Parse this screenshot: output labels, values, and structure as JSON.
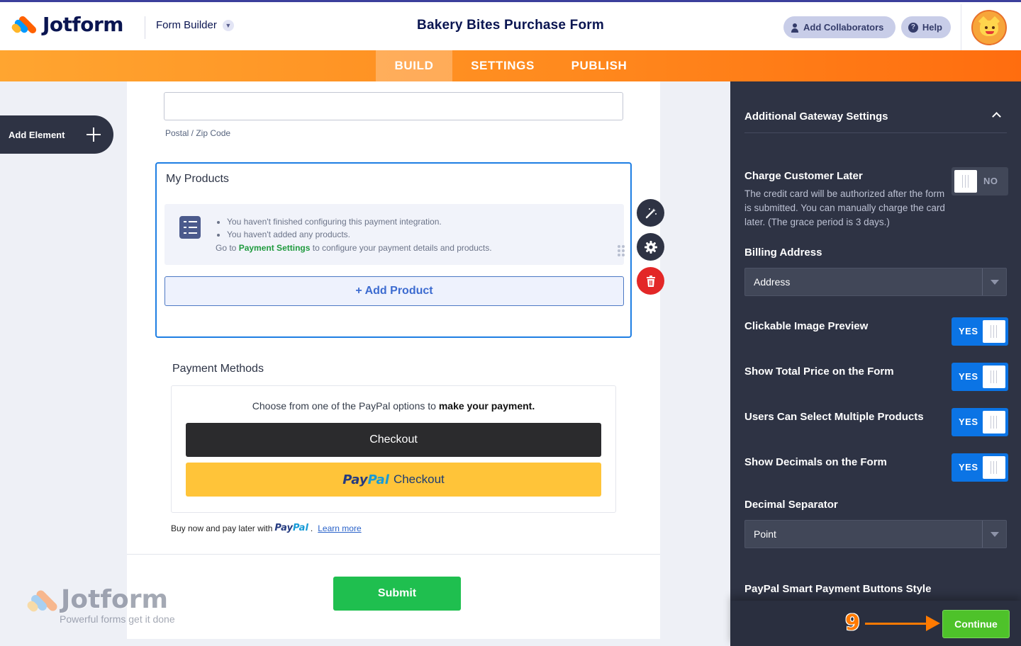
{
  "header": {
    "brand": "Jotform",
    "mode_label": "Form Builder",
    "form_title": "Bakery Bites Purchase Form",
    "collaborators_label": "Add Collaborators",
    "help_label": "Help"
  },
  "tabs": [
    {
      "label": "BUILD",
      "active": true
    },
    {
      "label": "SETTINGS",
      "active": false
    },
    {
      "label": "PUBLISH",
      "active": false
    }
  ],
  "sidebar": {
    "add_element_label": "Add Element"
  },
  "form": {
    "postal_label": "Postal / Zip Code",
    "products": {
      "title": "My Products",
      "notices": [
        "You haven't finished configuring this payment integration.",
        "You haven't added any products."
      ],
      "goto_prefix": "Go to",
      "goto_link": "Payment Settings",
      "goto_suffix": "to configure your payment details and products.",
      "add_product_label": "+ Add Product"
    },
    "payment_methods": {
      "title": "Payment Methods",
      "desc_prefix": "Choose from one of the PayPal options to",
      "desc_bold": "make your payment.",
      "checkout_label": "Checkout",
      "paypal_pay": "Pay",
      "paypal_pal": "Pal",
      "paypal_checkout": "Checkout",
      "paylater_text": "Buy now and pay later with",
      "paylater_pay": "Pay",
      "paylater_pal": "Pal",
      "paylater_dot": ".",
      "learn_more": "Learn more"
    },
    "submit_label": "Submit"
  },
  "watermark": {
    "brand": "Jotform",
    "tagline": "Powerful forms get it done"
  },
  "panel": {
    "section_title": "Additional Gateway Settings",
    "charge_later": {
      "title": "Charge Customer Later",
      "desc": "The credit card will be authorized after the form is submitted. You can manually charge the card later. (The grace period is 3 days.)",
      "toggle": "NO"
    },
    "billing_address": {
      "title": "Billing Address",
      "value": "Address"
    },
    "clickable_image_preview": {
      "title": "Clickable Image Preview",
      "toggle": "YES"
    },
    "show_total_price": {
      "title": "Show Total Price on the Form",
      "toggle": "YES"
    },
    "multiple_products": {
      "title": "Users Can Select Multiple Products",
      "toggle": "YES"
    },
    "show_decimals": {
      "title": "Show Decimals on the Form",
      "toggle": "YES"
    },
    "decimal_separator": {
      "title": "Decimal Separator",
      "value": "Point"
    },
    "smart_buttons_title": "PayPal Smart Payment Buttons Style",
    "step_number": "9",
    "continue_label": "Continue"
  }
}
